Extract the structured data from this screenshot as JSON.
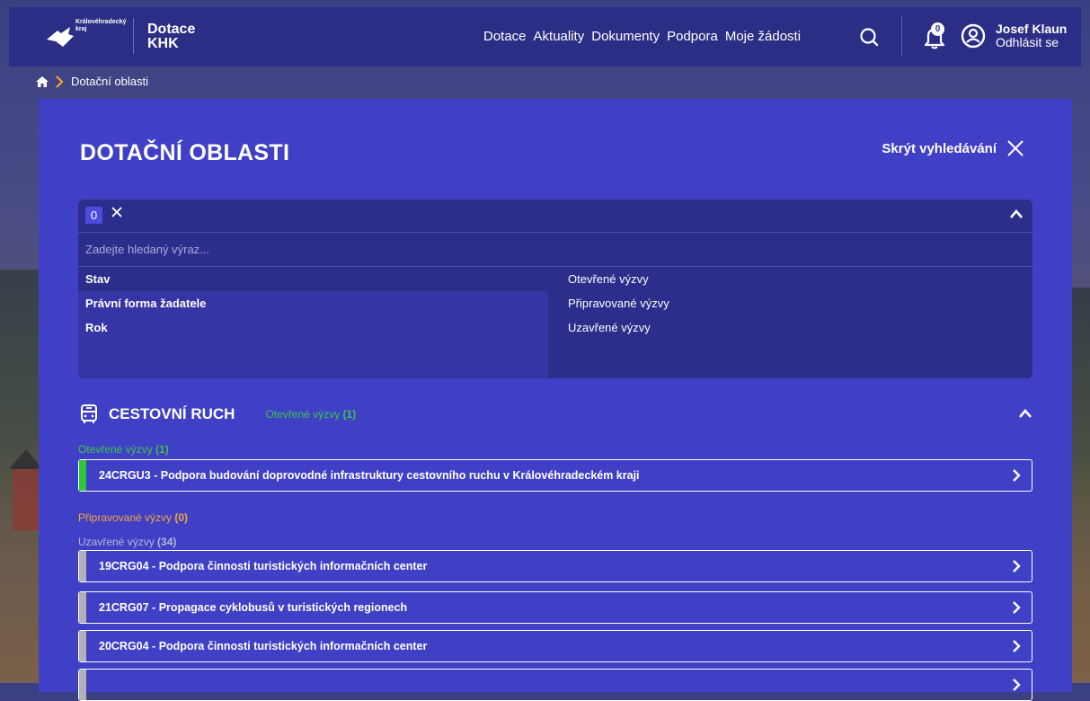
{
  "header": {
    "logo_text": "Královéhradecký kraj",
    "brand_line1": "Dotace",
    "brand_line2": "KHK",
    "nav": [
      "Dotace",
      "Aktuality",
      "Dokumenty",
      "Podpora",
      "Moje žádosti"
    ],
    "notification_count": "0",
    "user_name": "Josef Klaun",
    "logout_label": "Odhlásit se"
  },
  "breadcrumb": {
    "current": "Dotační oblasti"
  },
  "page": {
    "title": "DOTAČNÍ OBLASTI",
    "hide_search_label": "Skrýt vyhledávání"
  },
  "filter": {
    "chip_count": "0",
    "search_placeholder": "Zadejte hledaný výraz...",
    "categories": [
      "Stav",
      "Právní forma žadatele",
      "Rok"
    ],
    "options": [
      "Otevřené výzvy",
      "Připravované výzvy",
      "Uzavřené výzvy"
    ]
  },
  "section": {
    "title": "CESTOVNÍ RUCH",
    "summary_label": "Otevřené výzvy",
    "summary_count": "(1)",
    "groups": {
      "open_label": "Otevřené výzvy",
      "open_count": "(1)",
      "prepared_label": "Připravované výzvy",
      "prepared_count": "(0)",
      "closed_label": "Uzavřené výzvy",
      "closed_count": "(34)"
    },
    "open_calls": [
      "24CRGU3 - Podpora budování doprovodné infrastruktury cestovního ruchu v Královéhradeckém kraji"
    ],
    "closed_calls": [
      "19CRG04 - Podpora činnosti turistických informačních center",
      "21CRG07 - Propagace cyklobusů v turistických regionech",
      "20CRG04 - Podpora činnosti turistických informačních center"
    ]
  },
  "colors": {
    "header_bg": "#2c2e86",
    "panel_bg": "#4040c6",
    "open_green": "#3fc548",
    "prepared_orange": "#f2a53f",
    "closed_gray": "#b0b0b8",
    "breadcrumb_chevron": "#f5a623"
  }
}
